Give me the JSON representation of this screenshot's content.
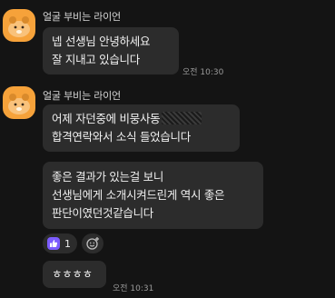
{
  "messages": {
    "group1": {
      "sender": "얼굴 부비는 라이언",
      "lines": [
        "넵 선생님 안녕하세요",
        "잘 지내고 있습니다"
      ],
      "time": "오전 10:30"
    },
    "group2": {
      "sender": "얼굴 부비는 라이언",
      "bubble1_lines": [
        "어제 자던중에 비뭉사동",
        "합격연락와서 소식 들었습니다"
      ],
      "bubble2_lines": [
        "좋은 결과가 있는걸 보니",
        "선생님에게 소개시켜드린게 역시 좋은",
        "판단이였던것같습니다"
      ],
      "reaction_count": "1",
      "bubble3_lines": [
        "ㅎㅎㅎㅎ"
      ],
      "time": "오전 10:31"
    }
  },
  "colors": {
    "background": "#141414",
    "bubble": "#2c2c2c",
    "avatar": "#f6a23a",
    "like_badge": "#7c5cff"
  },
  "icons": [
    "ryan-avatar-icon",
    "thumbs-up-icon",
    "add-emoji-icon"
  ]
}
